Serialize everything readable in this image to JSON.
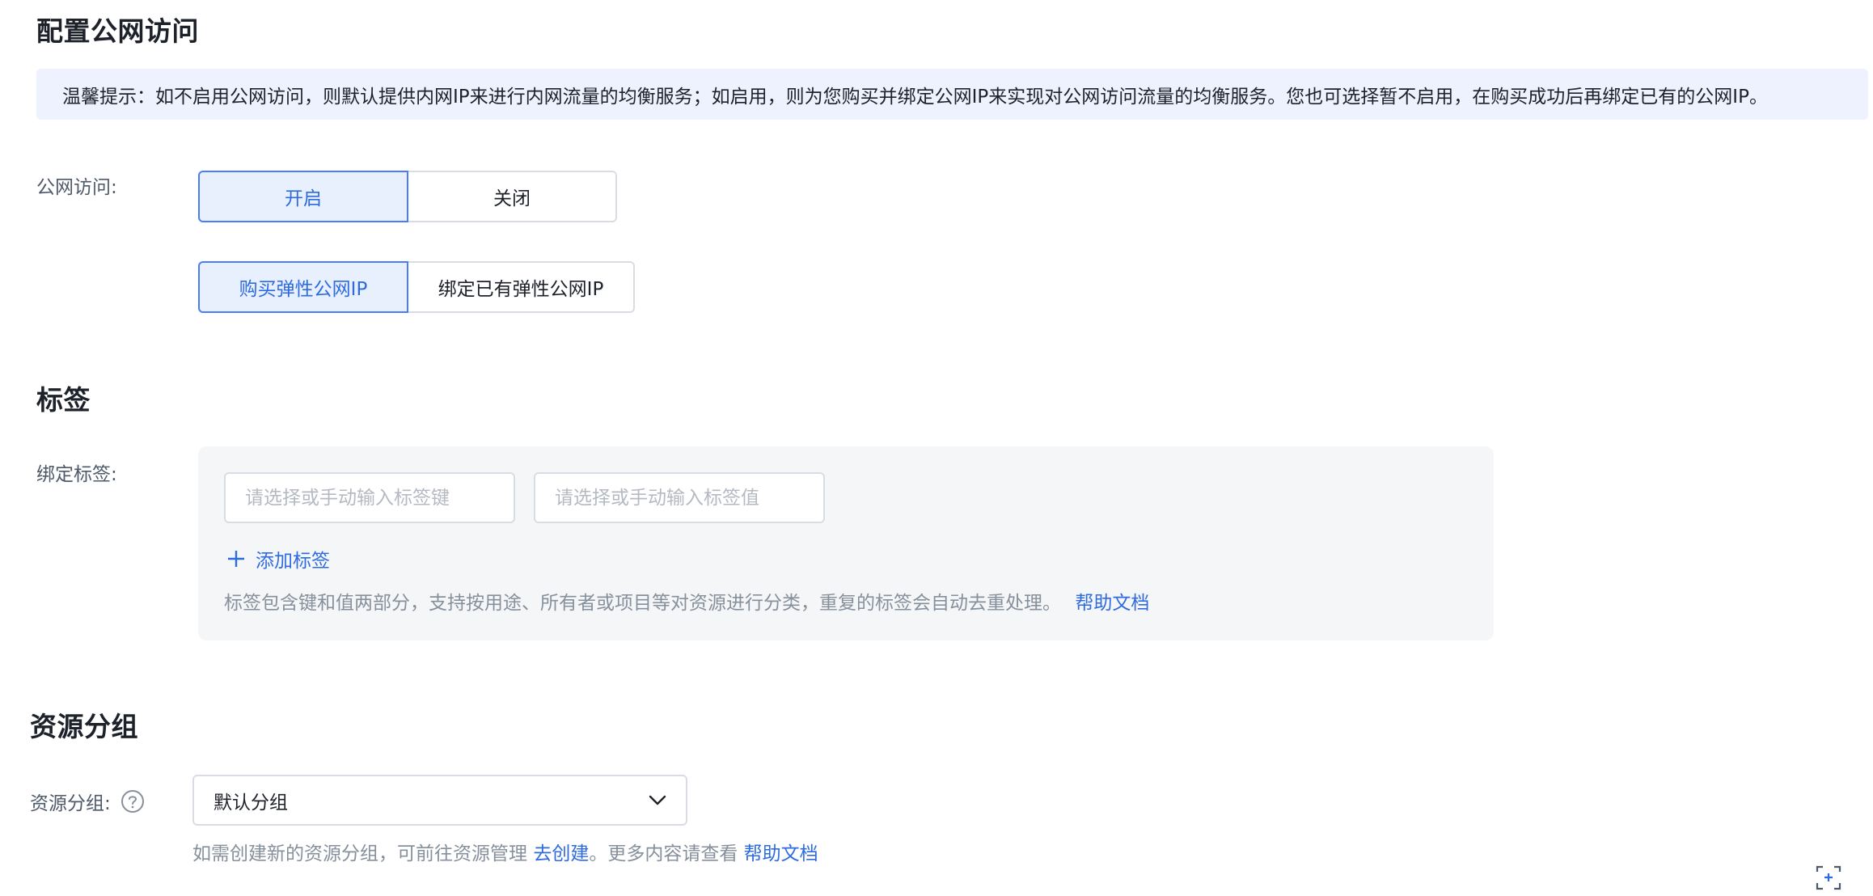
{
  "public_access": {
    "section_title": "配置公网访问",
    "tip": "温馨提示：如不启用公网访问，则默认提供内网IP来进行内网流量的均衡服务；如启用，则为您购买并绑定公网IP来实现对公网访问流量的均衡服务。您也可选择暂不启用，在购买成功后再绑定已有的公网IP。",
    "label": "公网访问:",
    "toggle": {
      "on_label": "开启",
      "off_label": "关闭",
      "selected": "开启"
    },
    "ip_mode": {
      "buy_label": "购买弹性公网IP",
      "bind_label": "绑定已有弹性公网IP",
      "selected": "购买弹性公网IP"
    }
  },
  "tags": {
    "section_title": "标签",
    "label": "绑定标签:",
    "key_placeholder": "请选择或手动输入标签键",
    "value_placeholder": "请选择或手动输入标签值",
    "add_label": "添加标签",
    "hint": "标签包含键和值两部分，支持按用途、所有者或项目等对资源进行分类，重复的标签会自动去重处理。",
    "help_link": "帮助文档"
  },
  "resource_group": {
    "section_title": "资源分组",
    "label": "资源分组:",
    "selected": "默认分组",
    "hint_prefix": "如需创建新的资源分组，可前往资源管理 ",
    "create_link": "去创建",
    "hint_middle": "。更多内容请查看 ",
    "help_link": "帮助文档"
  },
  "colors": {
    "accent": "#2f6be0",
    "tip_bg": "#edf2fe",
    "panel_bg": "#f5f6f8"
  },
  "icons": [
    "question-circle-icon",
    "plus-icon",
    "chevron-down-icon",
    "screenshot-scan-icon"
  ]
}
